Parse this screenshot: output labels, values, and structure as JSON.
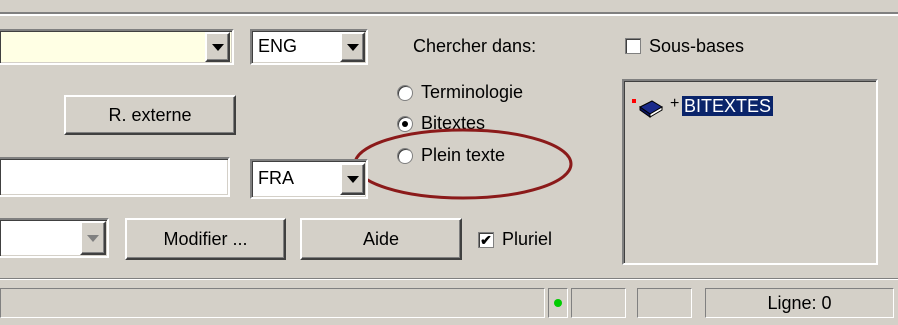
{
  "source_lang": {
    "value": "ENG"
  },
  "target_lang": {
    "value": "FRA"
  },
  "buttons": {
    "external": "R. externe",
    "modify": "Modifier ...",
    "help": "Aide"
  },
  "search_in": {
    "label": "Chercher dans:",
    "options": [
      "Terminologie",
      "Bitextes",
      "Plein texte"
    ],
    "selected": "Bitextes"
  },
  "plural": {
    "label": "Pluriel",
    "checked": true
  },
  "subbases": {
    "label": "Sous-bases",
    "checked": false
  },
  "tree": {
    "expander": "+",
    "item": "BITEXTES"
  },
  "status": {
    "line": "Ligne: 0"
  },
  "colors": {
    "highlight": "#0a246a",
    "annotation": "#8b1a1a",
    "indicator": "#00cc00"
  }
}
